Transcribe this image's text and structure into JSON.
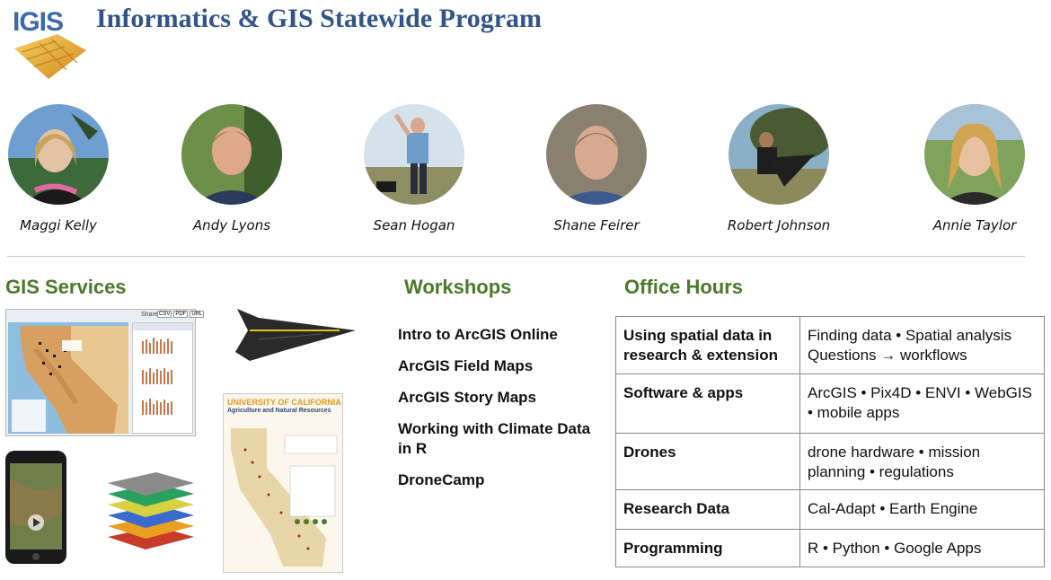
{
  "header": {
    "logo_text": "IGIS",
    "title": "Informatics & GIS Statewide Program"
  },
  "people": [
    {
      "name": "Maggi Kelly"
    },
    {
      "name": "Andy Lyons"
    },
    {
      "name": "Sean Hogan"
    },
    {
      "name": "Shane Feirer"
    },
    {
      "name": "Robert Johnson"
    },
    {
      "name": "Annie Taylor"
    }
  ],
  "sections": {
    "gis_services": "GIS Services",
    "workshops": "Workshops",
    "office_hours": "Office Hours"
  },
  "workshops": [
    "Intro to ArcGIS Online",
    "ArcGIS Field Maps",
    "ArcGIS Story Maps",
    "Working with Climate Data in R",
    "DroneCamp"
  ],
  "office_hours": [
    {
      "topic": "Using spatial data in research & extension",
      "details": "Finding data  •  Spatial analysis Questions → workflows"
    },
    {
      "topic": "Software & apps",
      "details": "ArcGIS  •  Pix4D  •  ENVI  • WebGIS  •  mobile apps"
    },
    {
      "topic": "Drones",
      "details": "drone hardware  •  mission planning  •  regulations"
    },
    {
      "topic": "Research Data",
      "details": "Cal-Adapt  •  Earth Engine"
    },
    {
      "topic": "Programming",
      "details": "R • Python • Google Apps"
    }
  ],
  "poster": {
    "header": "UNIVERSITY OF CALIFORNIA",
    "subheader": "Agriculture and Natural Resources"
  },
  "webmap": {
    "share_label": "Share:",
    "share_buttons": [
      "CSV",
      "PDF",
      "URL"
    ]
  },
  "colors": {
    "title": "#33548a",
    "section": "#4a7a2a",
    "logo_blue": "#3b6aa8",
    "logo_gold": "#e0b030"
  }
}
